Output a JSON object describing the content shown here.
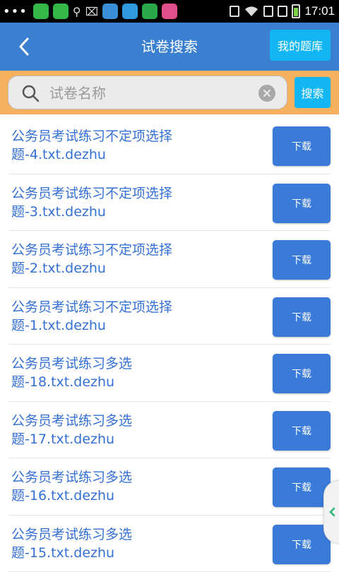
{
  "status_bar": {
    "time": "17:01",
    "dots": "•••"
  },
  "header": {
    "title": "试卷搜索",
    "library_button": "我的题库"
  },
  "search": {
    "placeholder": "试卷名称",
    "value": "",
    "button": "搜索"
  },
  "list": {
    "download_label": "下载",
    "items": [
      {
        "line1": "公务员考试练习不定项选择",
        "line2": "题-4.txt.dezhu"
      },
      {
        "line1": "公务员考试练习不定项选择",
        "line2": "题-3.txt.dezhu"
      },
      {
        "line1": "公务员考试练习不定项选择",
        "line2": "题-2.txt.dezhu"
      },
      {
        "line1": "公务员考试练习不定项选择",
        "line2": "题-1.txt.dezhu"
      },
      {
        "line1": "公务员考试练习多选",
        "line2": "题-18.txt.dezhu"
      },
      {
        "line1": "公务员考试练习多选",
        "line2": "题-17.txt.dezhu"
      },
      {
        "line1": "公务员考试练习多选",
        "line2": "题-16.txt.dezhu"
      },
      {
        "line1": "公务员考试练习多选",
        "line2": "题-15.txt.dezhu"
      }
    ]
  },
  "colors": {
    "header": "#3a7fd0",
    "search_bar": "#f7b05d",
    "accent_button": "#12b6f3",
    "download_button": "#3a7bd9",
    "item_text": "#3470d3"
  }
}
